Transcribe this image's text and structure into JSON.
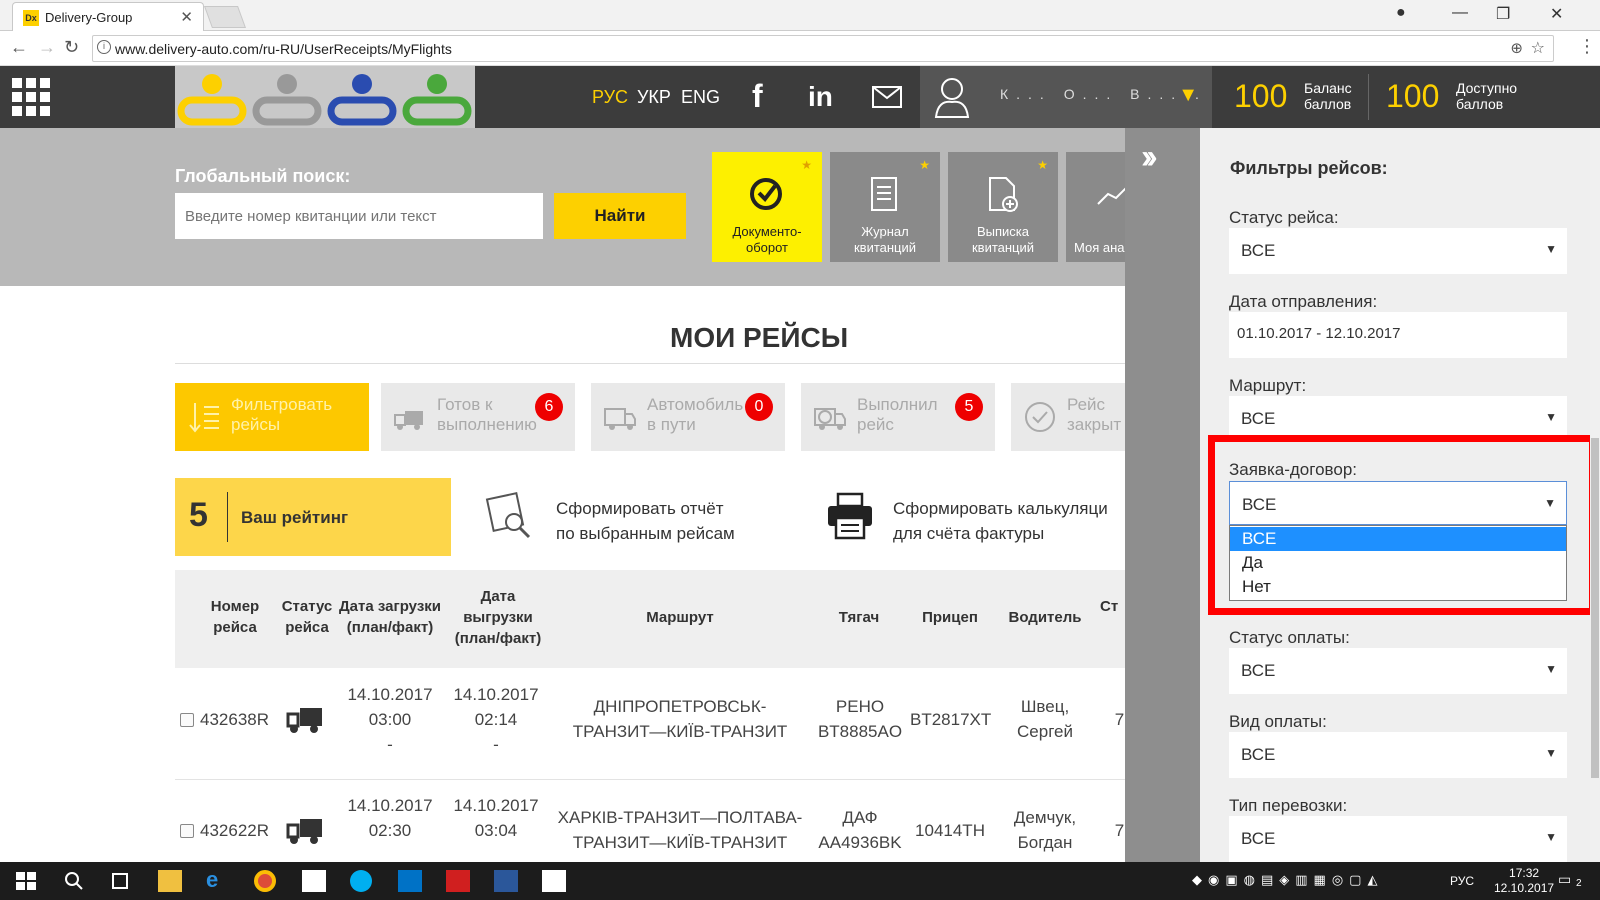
{
  "browser": {
    "tab_title": "Delivery-Group",
    "favicon_text": "Dx",
    "url": "www.delivery-auto.com/ru-RU/UserReceipts/MyFlights"
  },
  "header": {
    "langs": [
      "РУС",
      "УКР",
      "ENG"
    ],
    "user_name": "К... О... В... .",
    "balance_value": "100",
    "balance_label_1": "Баланс",
    "balance_label_2": "баллов",
    "available_value": "100",
    "available_label_1": "Доступно",
    "available_label_2": "баллов"
  },
  "search": {
    "label": "Глобальный поиск:",
    "placeholder": "Введите номер квитанции или текст",
    "button": "Найти"
  },
  "tiles": [
    {
      "line1": "Документо-",
      "line2": "оборот"
    },
    {
      "line1": "Журнал",
      "line2": "квитанций"
    },
    {
      "line1": "Выписка",
      "line2": "квитанций"
    },
    {
      "line1": "Моя ана",
      "line2": ""
    }
  ],
  "page_title": "МОИ РЕЙСЫ",
  "filters": [
    {
      "line1": "Фильтровать",
      "line2": "рейсы",
      "badge": ""
    },
    {
      "line1": "Готов к",
      "line2": "выполнению",
      "badge": "6"
    },
    {
      "line1": "Автомобиль",
      "line2": "в пути",
      "badge": "0"
    },
    {
      "line1": "Выполнил",
      "line2": "рейс",
      "badge": "5"
    },
    {
      "line1": "Рейс",
      "line2": "закрыт",
      "badge": ""
    }
  ],
  "rating": {
    "value": "5",
    "label": "Ваш рейтинг"
  },
  "actions": {
    "report_1": "Сформировать отчёт",
    "report_2": "по выбранным рейсам",
    "calc_1": "Сформировать калькуляци",
    "calc_2": "для счёта фактуры"
  },
  "table": {
    "headers": {
      "num_1": "Номер",
      "num_2": "рейса",
      "status_1": "Статус",
      "status_2": "рейса",
      "load_1": "Дата загрузки",
      "load_2": "(план/факт)",
      "unload_1": "Дата",
      "unload_2": "выгрузки",
      "unload_3": "(план/факт)",
      "route": "Маршрут",
      "tractor": "Тягач",
      "trailer": "Прицеп",
      "driver": "Водитель",
      "more": "Ст"
    },
    "rows": [
      {
        "num": "432638R",
        "load_date": "14.10.2017",
        "load_time": "03:00",
        "load_fact": "-",
        "unload_date": "14.10.2017",
        "unload_time": "02:14",
        "unload_fact": "-",
        "route_1": "ДНІПРОПЕТРОВСЬК-",
        "route_2": "ТРАНЗИТ—КИЇВ-ТРАНЗИТ",
        "tractor_1": "РЕНО",
        "tractor_2": "BT8885AO",
        "trailer": "BT2817XT",
        "driver_1": "Швец,",
        "driver_2": "Сергей",
        "more": "7"
      },
      {
        "num": "432622R",
        "load_date": "14.10.2017",
        "load_time": "02:30",
        "load_fact": "",
        "unload_date": "14.10.2017",
        "unload_time": "03:04",
        "unload_fact": "",
        "route_1": "ХАРКІВ-ТРАНЗИТ—ПОЛТАВА-",
        "route_2": "ТРАНЗИТ—КИЇВ-ТРАНЗИТ",
        "tractor_1": "ДАФ",
        "tractor_2": "AA4936BK",
        "trailer": "10414TH",
        "driver_1": "Демчук,",
        "driver_2": "Богдан",
        "more": "7"
      }
    ]
  },
  "panel": {
    "title": "Фильтры рейсов:",
    "fields": [
      {
        "label": "Статус рейса:",
        "value": "ВСЕ"
      },
      {
        "label": "Дата отправления:",
        "value": "01.10.2017 - 12.10.2017"
      },
      {
        "label": "Маршрут:",
        "value": "ВСЕ"
      },
      {
        "label": "Заявка-договор:",
        "value": "ВСЕ"
      },
      {
        "label": "Статус оплаты:",
        "value": "ВСЕ"
      },
      {
        "label": "Вид оплаты:",
        "value": "ВСЕ"
      },
      {
        "label": "Тип перевозки:",
        "value": "ВСЕ"
      }
    ],
    "dropdown_options": [
      "ВСЕ",
      "Да",
      "Нет"
    ]
  },
  "taskbar": {
    "time": "17:32",
    "date": "12.10.2017",
    "lang": "РУС",
    "notif_count": "2"
  },
  "colors": {
    "accent": "#fdd000",
    "highlight": "#ff0000",
    "selected": "#1e90ff"
  }
}
